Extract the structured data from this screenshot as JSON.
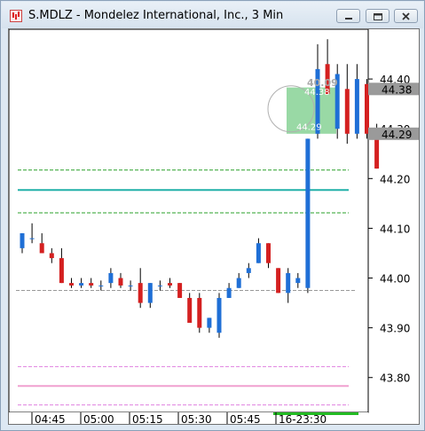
{
  "window": {
    "title": "S.MDLZ - Mondelez International, Inc., 3 Min",
    "buttons": [
      "minimize",
      "restore",
      "close"
    ]
  },
  "chart_data": {
    "type": "candlestick",
    "symbol": "S.MDLZ",
    "timeframe": "3 Min",
    "ylim": [
      43.73,
      44.5
    ],
    "y_ticks": [
      "44.40",
      "44.30",
      "44.20",
      "44.10",
      "44.00",
      "43.90",
      "43.80"
    ],
    "x_ticks": [
      "04:45",
      "05:00",
      "05:15",
      "05:30",
      "05:45",
      "16-23:30"
    ],
    "price_labels": [
      {
        "text": "44.38",
        "value": 44.38
      },
      {
        "text": "44.29",
        "value": 44.29
      }
    ],
    "annotations": [
      {
        "text": "40.09",
        "value": 44.393
      },
      {
        "text": "44.38",
        "value": 44.375
      },
      {
        "text": "44.29",
        "value": 44.305
      }
    ],
    "levels": [
      {
        "value": 44.217,
        "color": "#2aa02a",
        "style": "dashed"
      },
      {
        "value": 44.177,
        "color": "#20b0a8",
        "style": "solid"
      },
      {
        "value": 44.131,
        "color": "#2aa02a",
        "style": "dashed"
      },
      {
        "value": 43.975,
        "color": "#999999",
        "style": "dashed"
      },
      {
        "value": 43.822,
        "color": "#e080e0",
        "style": "dashed"
      },
      {
        "value": 43.783,
        "color": "#f0a0d0",
        "style": "solid"
      },
      {
        "value": 43.745,
        "color": "#e080e0",
        "style": "dashed"
      }
    ],
    "colors": {
      "up": "#1f6fd6",
      "down": "#d42020",
      "wick": "#000000"
    },
    "candles": [
      {
        "o": 44.06,
        "h": 44.09,
        "l": 44.05,
        "c": 44.09
      },
      {
        "o": 44.08,
        "h": 44.11,
        "l": 44.07,
        "c": 44.08
      },
      {
        "o": 44.07,
        "h": 44.09,
        "l": 44.05,
        "c": 44.05
      },
      {
        "o": 44.05,
        "h": 44.06,
        "l": 44.03,
        "c": 44.04
      },
      {
        "o": 44.04,
        "h": 44.06,
        "l": 43.99,
        "c": 43.99
      },
      {
        "o": 43.99,
        "h": 44.0,
        "l": 43.98,
        "c": 43.985
      },
      {
        "o": 43.985,
        "h": 44.0,
        "l": 43.98,
        "c": 43.99
      },
      {
        "o": 43.99,
        "h": 44.0,
        "l": 43.98,
        "c": 43.985
      },
      {
        "o": 43.985,
        "h": 43.995,
        "l": 43.975,
        "c": 43.985
      },
      {
        "o": 43.99,
        "h": 44.02,
        "l": 43.98,
        "c": 44.01
      },
      {
        "o": 44.0,
        "h": 44.01,
        "l": 43.98,
        "c": 43.985
      },
      {
        "o": 43.985,
        "h": 43.995,
        "l": 43.975,
        "c": 43.985
      },
      {
        "o": 43.99,
        "h": 44.02,
        "l": 43.94,
        "c": 43.95
      },
      {
        "o": 43.95,
        "h": 43.99,
        "l": 43.94,
        "c": 43.99
      },
      {
        "o": 43.985,
        "h": 43.995,
        "l": 43.975,
        "c": 43.985
      },
      {
        "o": 43.99,
        "h": 44.0,
        "l": 43.98,
        "c": 43.985
      },
      {
        "o": 43.99,
        "h": 43.99,
        "l": 43.96,
        "c": 43.96
      },
      {
        "o": 43.96,
        "h": 43.97,
        "l": 43.91,
        "c": 43.91
      },
      {
        "o": 43.96,
        "h": 43.97,
        "l": 43.89,
        "c": 43.9
      },
      {
        "o": 43.9,
        "h": 43.92,
        "l": 43.89,
        "c": 43.92
      },
      {
        "o": 43.89,
        "h": 43.97,
        "l": 43.88,
        "c": 43.96
      },
      {
        "o": 43.96,
        "h": 43.99,
        "l": 43.96,
        "c": 43.98
      },
      {
        "o": 43.98,
        "h": 44.01,
        "l": 43.98,
        "c": 44.0
      },
      {
        "o": 44.01,
        "h": 44.03,
        "l": 44.0,
        "c": 44.02
      },
      {
        "o": 44.03,
        "h": 44.08,
        "l": 44.03,
        "c": 44.07
      },
      {
        "o": 44.07,
        "h": 44.07,
        "l": 44.02,
        "c": 44.03
      },
      {
        "o": 44.02,
        "h": 44.02,
        "l": 43.97,
        "c": 43.97
      },
      {
        "o": 43.97,
        "h": 44.02,
        "l": 43.95,
        "c": 44.01
      },
      {
        "o": 43.99,
        "h": 44.01,
        "l": 43.98,
        "c": 44.0
      },
      {
        "o": 43.98,
        "h": 44.28,
        "l": 43.97,
        "c": 44.28
      },
      {
        "o": 44.29,
        "h": 44.47,
        "l": 44.28,
        "c": 44.42
      },
      {
        "o": 44.43,
        "h": 44.48,
        "l": 44.37,
        "c": 44.37
      },
      {
        "o": 44.3,
        "h": 44.43,
        "l": 44.28,
        "c": 44.41
      },
      {
        "o": 44.38,
        "h": 44.43,
        "l": 44.27,
        "c": 44.29
      },
      {
        "o": 44.29,
        "h": 44.43,
        "l": 44.28,
        "c": 44.4
      },
      {
        "o": 44.39,
        "h": 44.4,
        "l": 44.28,
        "c": 44.29
      },
      {
        "o": 44.29,
        "h": 44.31,
        "l": 44.22,
        "c": 44.22
      }
    ]
  }
}
